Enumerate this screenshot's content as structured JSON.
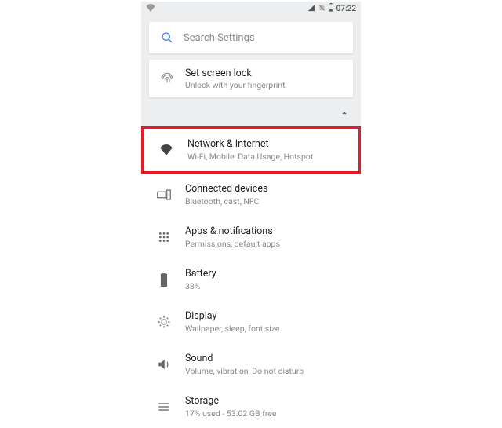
{
  "status": {
    "time": "07:22"
  },
  "search": {
    "placeholder": "Search Settings"
  },
  "lock_card": {
    "title": "Set screen lock",
    "subtitle": "Unlock with your fingerprint"
  },
  "items": [
    {
      "title": "Network & Internet",
      "subtitle": "Wi-Fi, Mobile, Data Usage, Hotspot",
      "highlight": true
    },
    {
      "title": "Connected devices",
      "subtitle": "Bluetooth, cast, NFC"
    },
    {
      "title": "Apps & notifications",
      "subtitle": "Permissions, default apps"
    },
    {
      "title": "Battery",
      "subtitle": "33%"
    },
    {
      "title": "Display",
      "subtitle": "Wallpaper, sleep, font size"
    },
    {
      "title": "Sound",
      "subtitle": "Volume, vibration, Do not disturb"
    },
    {
      "title": "Storage",
      "subtitle": "17% used - 53.02 GB free"
    }
  ]
}
